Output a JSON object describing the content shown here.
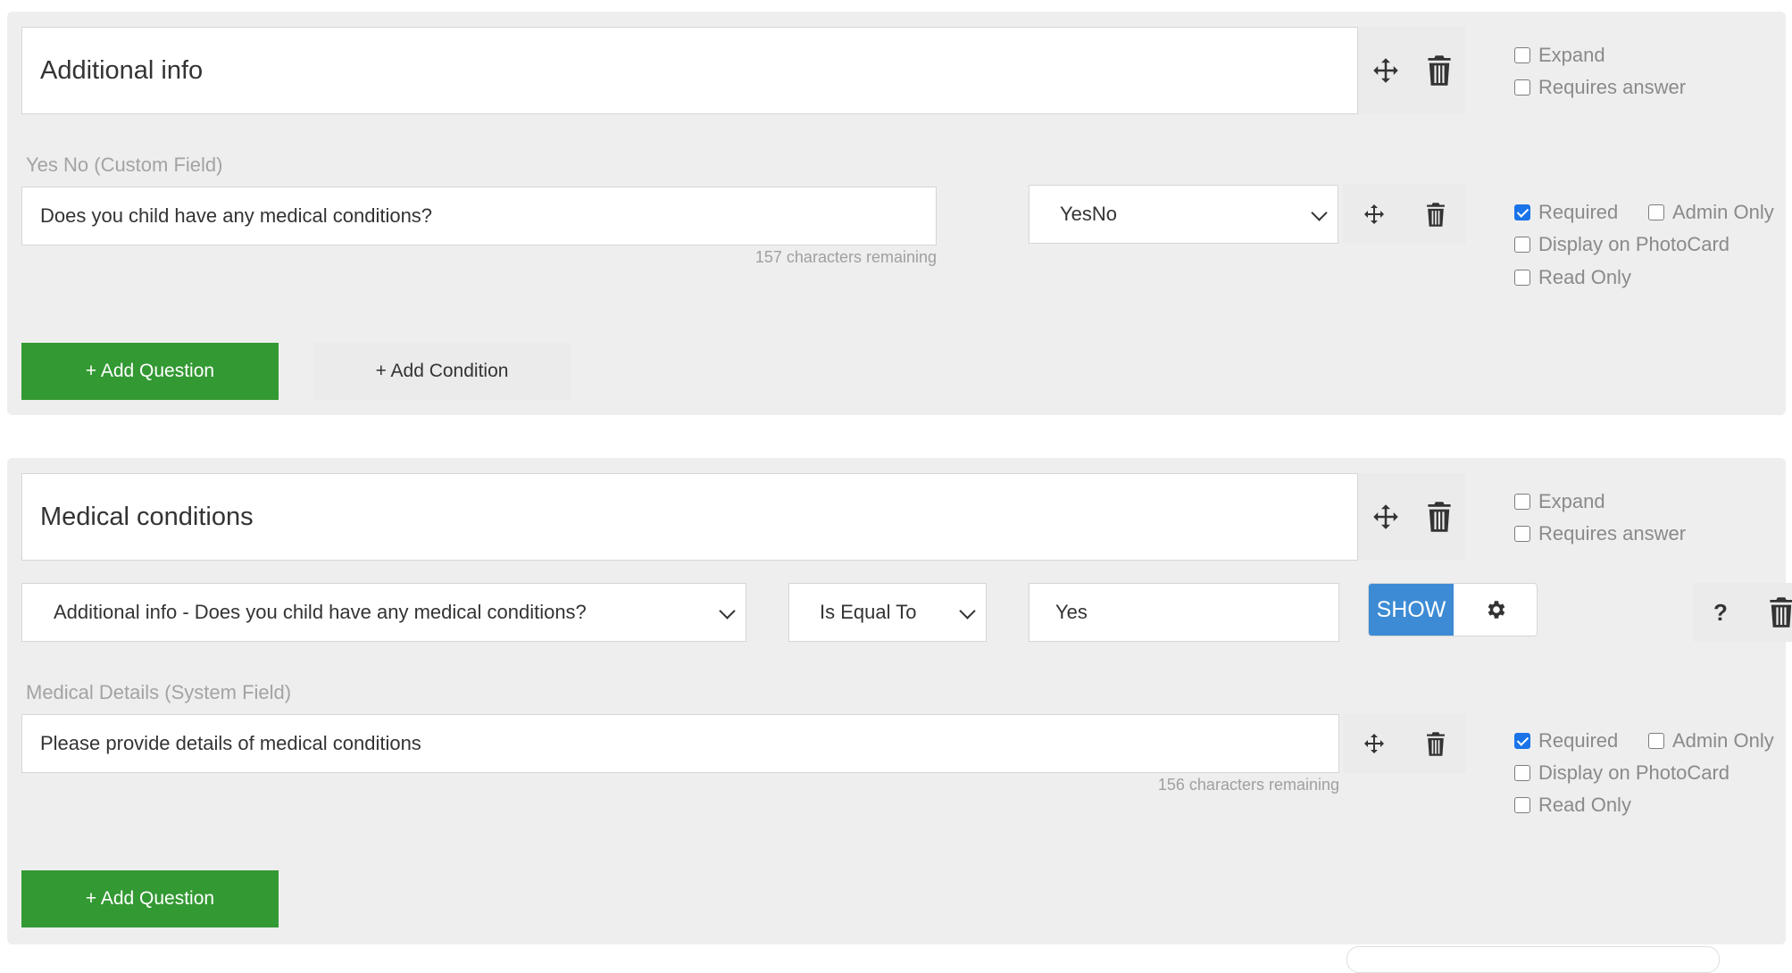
{
  "sections": [
    {
      "title": "Additional info",
      "options": [
        "Expand",
        "Requires answer"
      ],
      "question": {
        "type_label": "Yes No (Custom Field)",
        "text": "Does you child have any medical conditions?",
        "remaining": "157 characters remaining",
        "field_type": "YesNo",
        "flags": {
          "required": "Required",
          "admin_only": "Admin Only",
          "display_photocard": "Display on PhotoCard",
          "read_only": "Read Only"
        }
      },
      "add_question": "+ Add Question",
      "add_condition": "+ Add Condition"
    },
    {
      "title": "Medical conditions",
      "options": [
        "Expand",
        "Requires answer"
      ],
      "condition": {
        "question": "Additional info - Does you child have any medical conditions?",
        "operator": "Is Equal To",
        "value": "Yes",
        "action": "SHOW",
        "help": "?"
      },
      "question": {
        "type_label": "Medical Details (System Field)",
        "text": "Please provide details of medical conditions",
        "remaining": "156 characters remaining",
        "flags": {
          "required": "Required",
          "admin_only": "Admin Only",
          "display_photocard": "Display on PhotoCard",
          "read_only": "Read Only"
        }
      },
      "add_question": "+ Add Question"
    }
  ],
  "colors": {
    "accent_green": "#339933",
    "show_blue": "#3d8bd4",
    "check_blue": "#1a73e8"
  },
  "icons": [
    "move-icon",
    "trash-icon",
    "gear-icon",
    "help-icon",
    "chevron-down-icon"
  ]
}
